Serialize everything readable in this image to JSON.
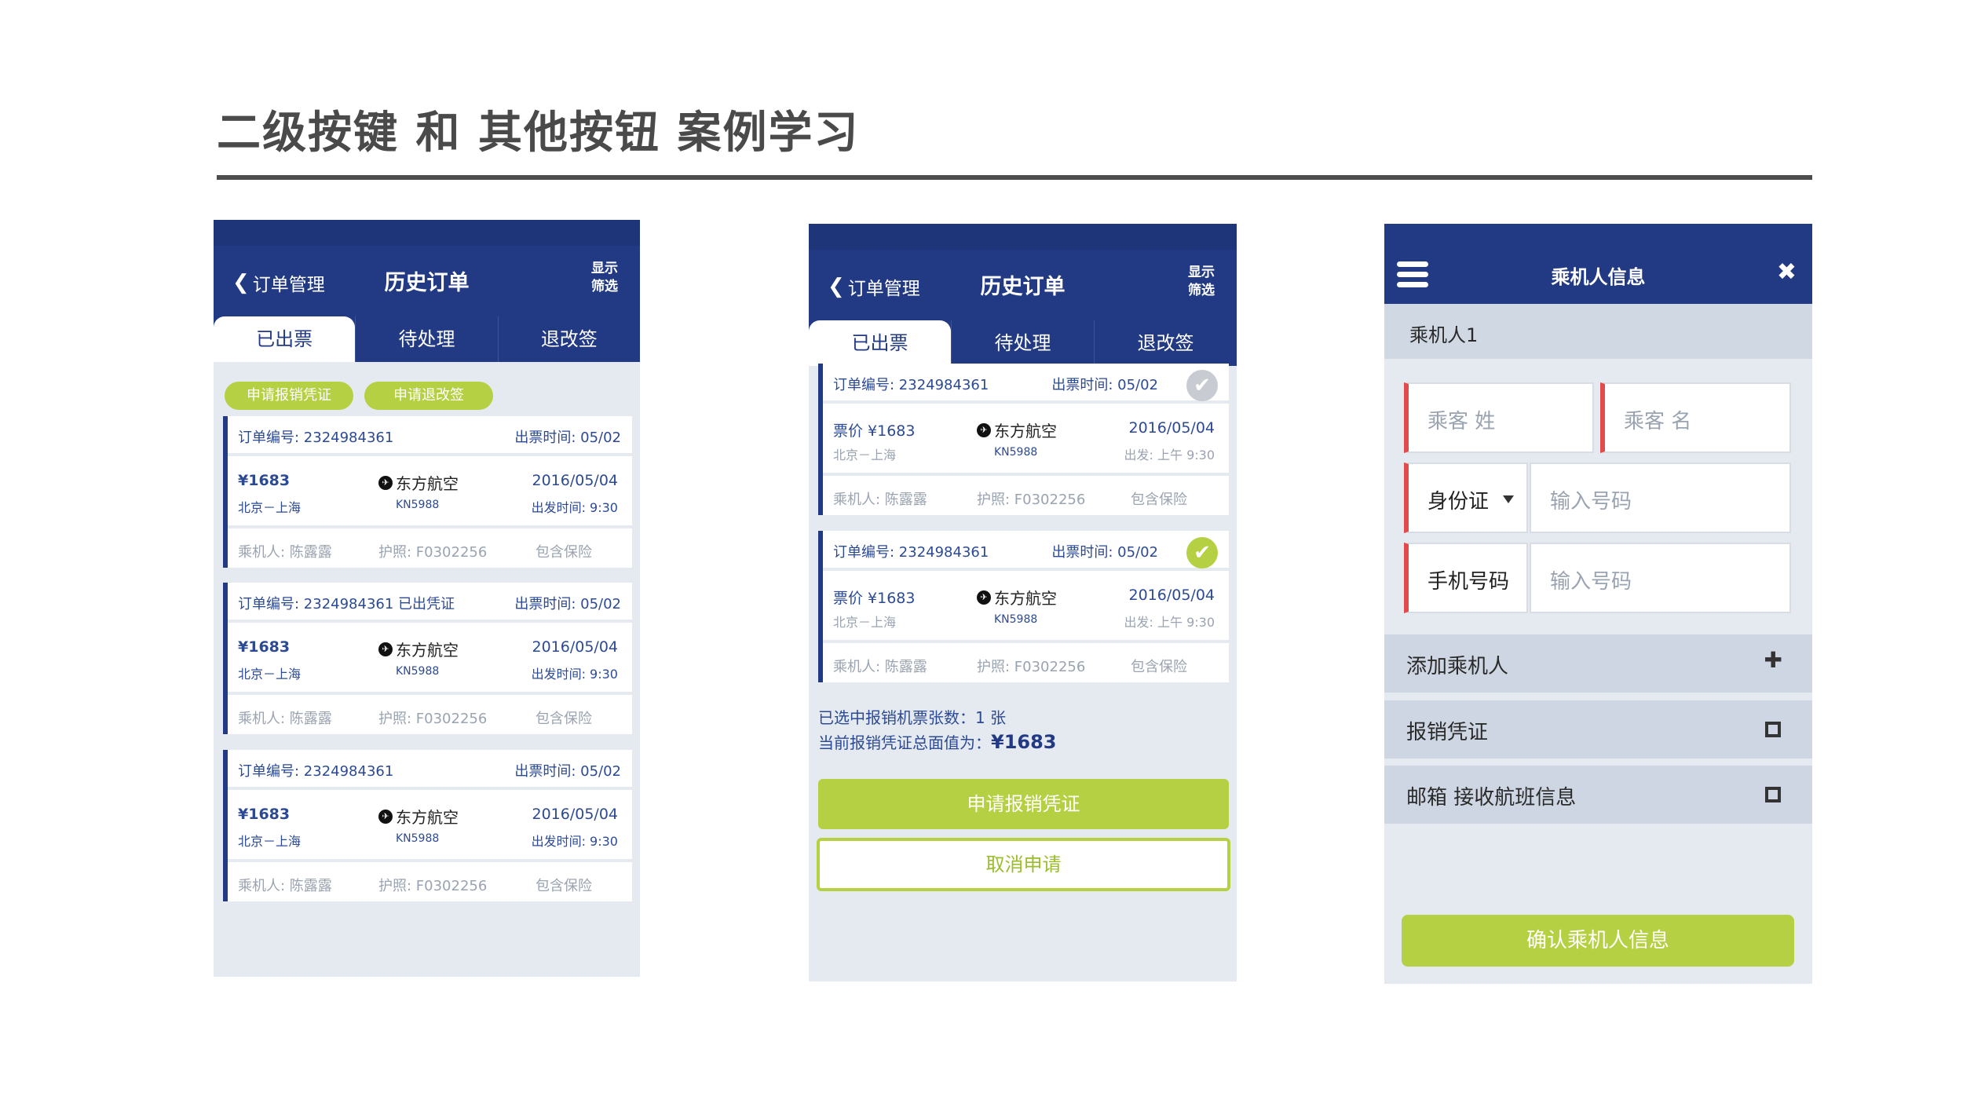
{
  "page": {
    "title": "二级按键 和 其他按钮 案例学习"
  },
  "nav": {
    "back_label": "订单管理",
    "title": "历史订单",
    "right_line1": "显示",
    "right_line2": "筛选",
    "chevron_icon": "chevron-left-icon"
  },
  "tabs": [
    "已出票",
    "待处理",
    "退改签"
  ],
  "screen1": {
    "pills": [
      "申请报销凭证",
      "申请退改签"
    ],
    "orders": [
      {
        "order_no": "订单编号: 2324984361",
        "issue_time": "出票时间: 05/02",
        "price": "¥1683",
        "route": "北京－上海",
        "airline": "东方航空",
        "flight": "KN5988",
        "date": "2016/05/04",
        "depart": "出发时间: 9:30",
        "passenger": "乘机人: 陈露露",
        "passport": "护照: F0302256",
        "insurance": "包含保险"
      },
      {
        "order_no": "订单编号: 2324984361 已出凭证",
        "issue_time": "出票时间: 05/02",
        "price": "¥1683",
        "route": "北京－上海",
        "airline": "东方航空",
        "flight": "KN5988",
        "date": "2016/05/04",
        "depart": "出发时间: 9:30",
        "passenger": "乘机人: 陈露露",
        "passport": "护照: F0302256",
        "insurance": "包含保险"
      },
      {
        "order_no": "订单编号: 2324984361",
        "issue_time": "出票时间: 05/02",
        "price": "¥1683",
        "route": "北京－上海",
        "airline": "东方航空",
        "flight": "KN5988",
        "date": "2016/05/04",
        "depart": "出发时间: 9:30",
        "passenger": "乘机人: 陈露露",
        "passport": "护照: F0302256",
        "insurance": "包含保险"
      }
    ]
  },
  "screen2": {
    "orders": [
      {
        "order_no": "订单编号: 2324984361",
        "issue_time": "出票时间: 05/02",
        "price": "票价 ¥1683",
        "route": "北京－上海",
        "airline": "东方航空",
        "flight": "KN5988",
        "date": "2016/05/04",
        "depart": "出发: 上午 9:30",
        "passenger": "乘机人: 陈露露",
        "passport": "护照: F0302256",
        "insurance": "包含保险",
        "selected": false
      },
      {
        "order_no": "订单编号: 2324984361",
        "issue_time": "出票时间: 05/02",
        "price": "票价 ¥1683",
        "route": "北京－上海",
        "airline": "东方航空",
        "flight": "KN5988",
        "date": "2016/05/04",
        "depart": "出发: 上午 9:30",
        "passenger": "乘机人: 陈露露",
        "passport": "护照: F0302256",
        "insurance": "包含保险",
        "selected": true
      }
    ],
    "summary_count": "已选中报销机票张数：1 张",
    "summary_total_label": "当前报销凭证总面值为：",
    "summary_total_value": "¥1683",
    "primary_button": "申请报销凭证",
    "secondary_button": "取消申请",
    "colors": {
      "accent": "#b5d042",
      "navy": "#223a84",
      "check_inactive": "#c8cbd1"
    }
  },
  "screen3": {
    "title": "乘机人信息",
    "menu_icon": "hamburger-menu-icon",
    "close_icon": "close-icon",
    "section_label": "乘机人1",
    "surname_placeholder": "乘客 姓",
    "givenname_placeholder": "乘客 名",
    "id_type": "身份证",
    "id_placeholder": "输入号码",
    "phone_label": "手机号码",
    "phone_placeholder": "输入号码",
    "add_passenger": "添加乘机人",
    "reimburse": "报销凭证",
    "email_flight": "邮箱 接收航班信息",
    "confirm_button": "确认乘机人信息",
    "colors": {
      "required": "#e24b4b"
    }
  }
}
